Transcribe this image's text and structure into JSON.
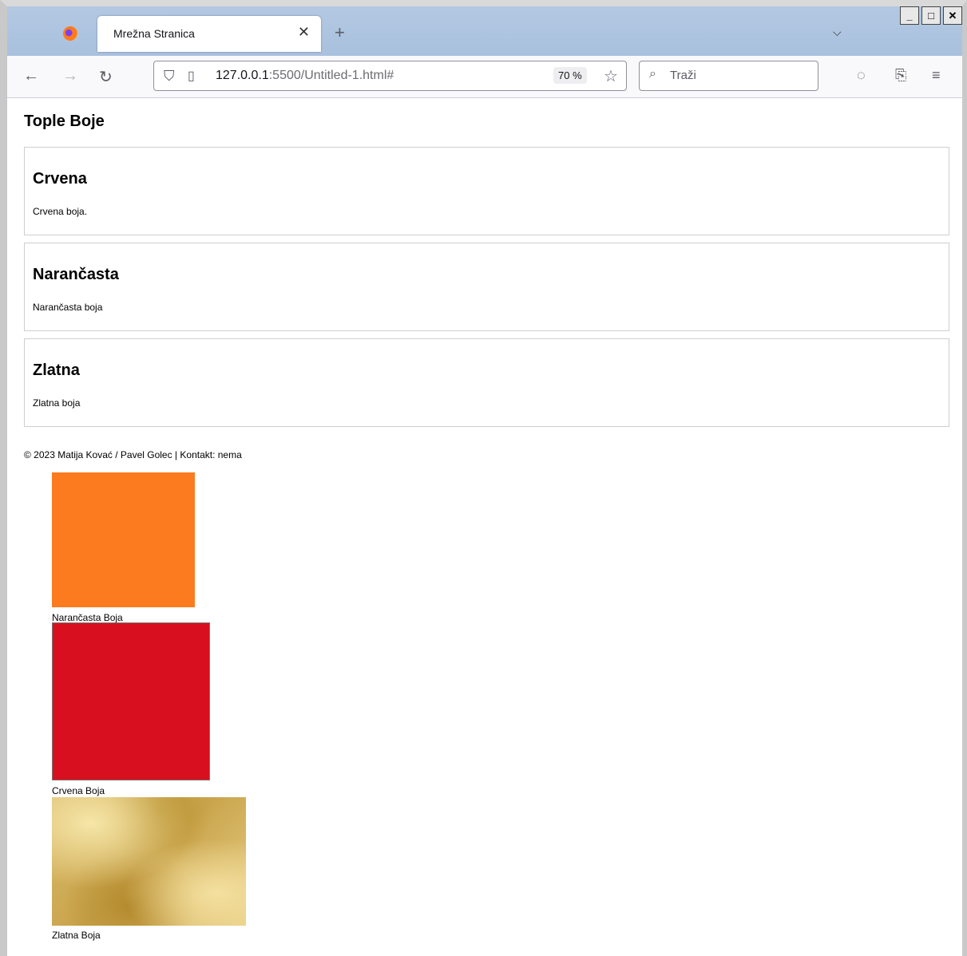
{
  "browser": {
    "tab_title": "Mrežna Stranica",
    "url_host": "127.0.0.1",
    "url_path": ":5500/Untitled-1.html#",
    "zoom": "70 %",
    "search_placeholder": "Traži"
  },
  "page": {
    "title": "Tople Boje",
    "cards": [
      {
        "heading": "Crvena",
        "text": "Crvena boja."
      },
      {
        "heading": "Narančasta",
        "text": "Narančasta boja"
      },
      {
        "heading": "Zlatna",
        "text": "Zlatna boja"
      }
    ],
    "footer": "© 2023 Matija Kovać / Pavel Golec | Kontakt: nema",
    "swatches": [
      {
        "caption": "Narančasta Boja",
        "color": "#fb7b1e"
      },
      {
        "caption": "Crvena Boja",
        "color": "#d80f1e"
      },
      {
        "caption": "Zlatna Boja",
        "color": "#d4b15a"
      }
    ]
  }
}
